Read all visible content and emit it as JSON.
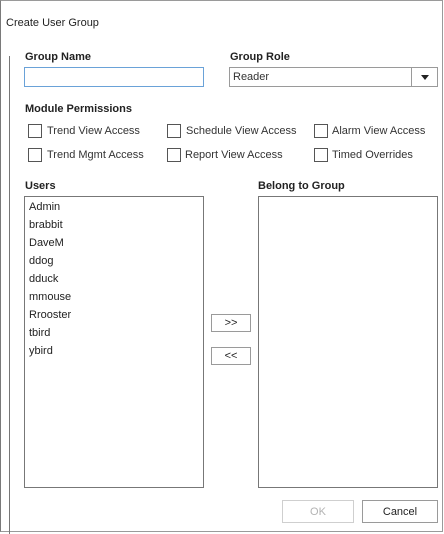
{
  "window": {
    "title": "Create User Group"
  },
  "group_name": {
    "label": "Group Name",
    "value": ""
  },
  "group_role": {
    "label": "Group Role",
    "value": "Reader"
  },
  "module_permissions": {
    "label": "Module Permissions",
    "items": [
      {
        "label": "Trend View Access",
        "checked": false
      },
      {
        "label": "Schedule View Access",
        "checked": false
      },
      {
        "label": "Alarm View Access",
        "checked": false
      },
      {
        "label": "Trend Mgmt Access",
        "checked": false
      },
      {
        "label": "Report View Access",
        "checked": false
      },
      {
        "label": "Timed Overrides",
        "checked": false
      }
    ]
  },
  "users": {
    "label": "Users",
    "items": [
      "Admin",
      "brabbit",
      "DaveM",
      "ddog",
      "dduck",
      "mmouse",
      "Rrooster",
      "tbird",
      "ybird"
    ]
  },
  "belong_to_group": {
    "label": "Belong to Group",
    "items": []
  },
  "buttons": {
    "add": ">>",
    "remove": "<<",
    "ok": "OK",
    "cancel": "Cancel"
  }
}
